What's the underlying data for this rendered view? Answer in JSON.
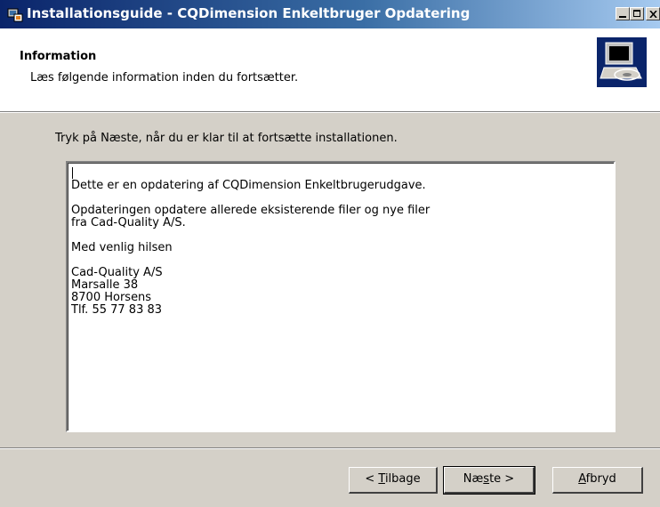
{
  "window": {
    "title": "Installationsguide - CQDimension Enkeltbruger Opdatering"
  },
  "header": {
    "title": "Information",
    "subtitle": "Læs følgende information inden du fortsætter.",
    "icon": "computer-install-icon"
  },
  "main": {
    "instruction": "Tryk på Næste, når du er klar til at fortsætte installationen.",
    "info_text": "\nDette er en opdatering af CQDimension Enkeltbrugerudgave.\n\nOpdateringen opdatere allerede eksisterende filer og nye filer\nfra Cad-Quality A/S.\n\nMed venlig hilsen\n\nCad-Quality A/S\nMarsalle 38\n8700 Horsens\nTlf. 55 77 83 83"
  },
  "buttons": {
    "back": {
      "prefix": "< ",
      "accel": "T",
      "rest": "ilbage"
    },
    "next": {
      "pre": "Næ",
      "accel": "s",
      "rest": "te >"
    },
    "cancel": {
      "accel": "A",
      "rest": "fbryd"
    }
  },
  "colors": {
    "title_gradient_start": "#0a246a",
    "title_gradient_end": "#a6caf0",
    "dialog_face": "#d4d0c8"
  }
}
